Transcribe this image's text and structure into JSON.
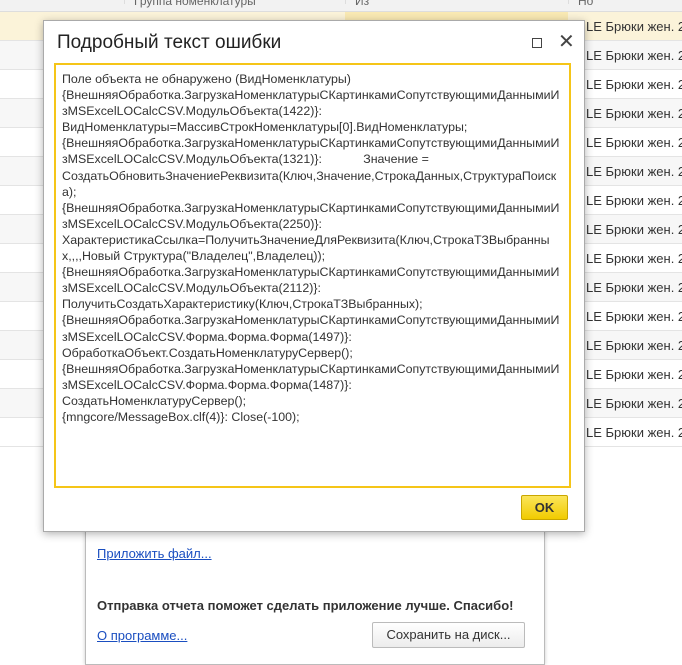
{
  "background_table": {
    "headers": [
      "Группа номенклатуры",
      "Из",
      "Но"
    ],
    "rows": [
      "LE Брюки жен. 2",
      "LE Брюки жен. 2",
      "LE Брюки жен. 2",
      "LE Брюки жен. 2",
      "LE Брюки жен. 2",
      "LE Брюки жен. 2",
      "LE Брюки жен. 2",
      "LE Брюки жен. 2",
      "LE Брюки жен. 2",
      "LE Брюки жен. 2",
      "LE Брюки жен. 2",
      "LE Брюки жен. 2",
      "LE Брюки жен. 2",
      "LE Брюки жен. 2",
      "LE Брюки жен. 2"
    ]
  },
  "report_dialog": {
    "attach_file": "Приложить файл...",
    "thanks": "Отправка отчета поможет сделать приложение лучше. Спасибо!",
    "about": "О программе...",
    "save_to_disk": "Сохранить на диск..."
  },
  "error_dialog": {
    "title": "Подробный текст ошибки",
    "text": "Поле объекта не обнаружено (ВидНоменклатуры)\n{ВнешняяОбработка.ЗагрузкаНоменклатурыСКартинкамиСопутствующимиДанными­ИзMSExcelLOCalcCSV.МодульОбъекта(1422)}:\nВидНоменклатуры=МассивСтрокНоменклатуры[0].ВидНоменклатуры;\n{ВнешняяОбработка.ЗагрузкаНоменклатурыСКартинкамиСопутствующимиДанными­ИзMSExcelLOCalcCSV.МодульОбъекта(1321)}:            Значение =\nСоздатьОбновитьЗначениеРеквизита(Ключ,Значение,СтрокаДанных,СтруктураПоиска);\n{ВнешняяОбработка.ЗагрузкаНоменклатурыСКартинкамиСопутствующимиДанными­ИзMSExcelLOCalcCSV.МодульОбъекта(2250)}:\nХарактеристикаСсылка=ПолучитьЗначениеДляРеквизита(Ключ,СтрокаТЗВыбранных,,,,Новый Структура(\"Владелец\",Владелец));\n{ВнешняяОбработка.ЗагрузкаНоменклатурыСКартинкамиСопутствующимиДанными­ИзMSExcelLOCalcCSV.МодульОбъекта(2112)}:\nПолучитьСоздатьХарактеристику(Ключ,СтрокаТЗВыбранных);\n{ВнешняяОбработка.ЗагрузкаНоменклатурыСКартинкамиСопутствующимиДанными­ИзMSExcelLOCalcCSV.Форма.Форма.Форма(1497)}:\nОбработкаОбъект.СоздатьНоменклатуруСервер();\n{ВнешняяОбработка.ЗагрузкаНоменклатурыСКартинкамиСопутствующимиДанными­ИзMSExcelLOCalcCSV.Форма.Форма.Форма(1487)}:\nСоздатьНоменклатуруСервер();\n{mngcore/MessageBox.clf(4)}: Close(-100);",
    "ok_label": "OK"
  }
}
